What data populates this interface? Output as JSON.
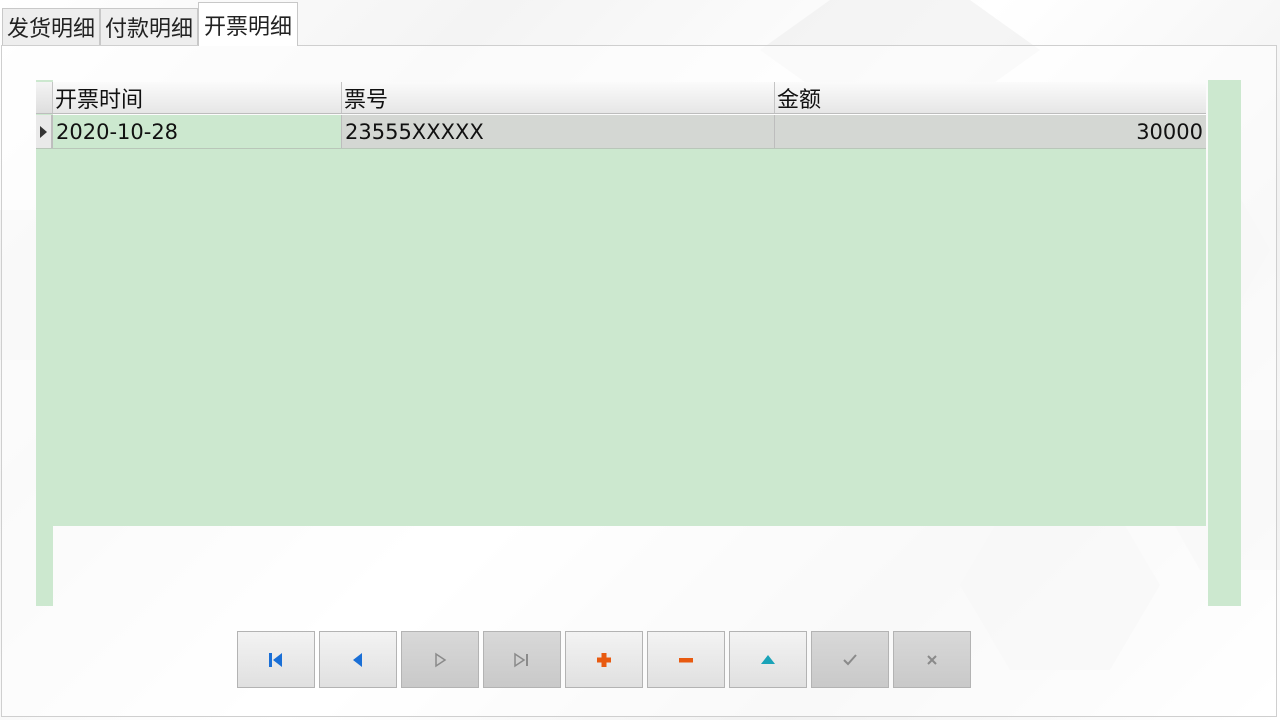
{
  "tabs": [
    {
      "label": "发货明细",
      "active": false
    },
    {
      "label": "付款明细",
      "active": false
    },
    {
      "label": "开票明细",
      "active": true
    }
  ],
  "grid": {
    "columns": [
      "开票时间",
      "票号",
      "金额"
    ],
    "rows": [
      {
        "date": "2020-10-28",
        "invoice_no": "23555XXXXX",
        "amount": "30000"
      }
    ]
  },
  "navigator": {
    "buttons": [
      {
        "name": "first-record-button",
        "icon": "first-icon",
        "enabled": true
      },
      {
        "name": "prior-record-button",
        "icon": "prior-icon",
        "enabled": true
      },
      {
        "name": "next-record-button",
        "icon": "next-icon",
        "enabled": false
      },
      {
        "name": "last-record-button",
        "icon": "last-icon",
        "enabled": false
      },
      {
        "name": "insert-record-button",
        "icon": "plus-icon",
        "enabled": true
      },
      {
        "name": "delete-record-button",
        "icon": "minus-icon",
        "enabled": true
      },
      {
        "name": "edit-record-button",
        "icon": "up-triangle-icon",
        "enabled": true
      },
      {
        "name": "post-record-button",
        "icon": "check-icon",
        "enabled": false
      },
      {
        "name": "cancel-record-button",
        "icon": "x-icon",
        "enabled": false
      }
    ]
  },
  "colors": {
    "grid_green": "#cce8cf",
    "nav_blue": "#1a6fd6",
    "nav_orange": "#e85a10",
    "nav_teal": "#1aa3b8"
  }
}
